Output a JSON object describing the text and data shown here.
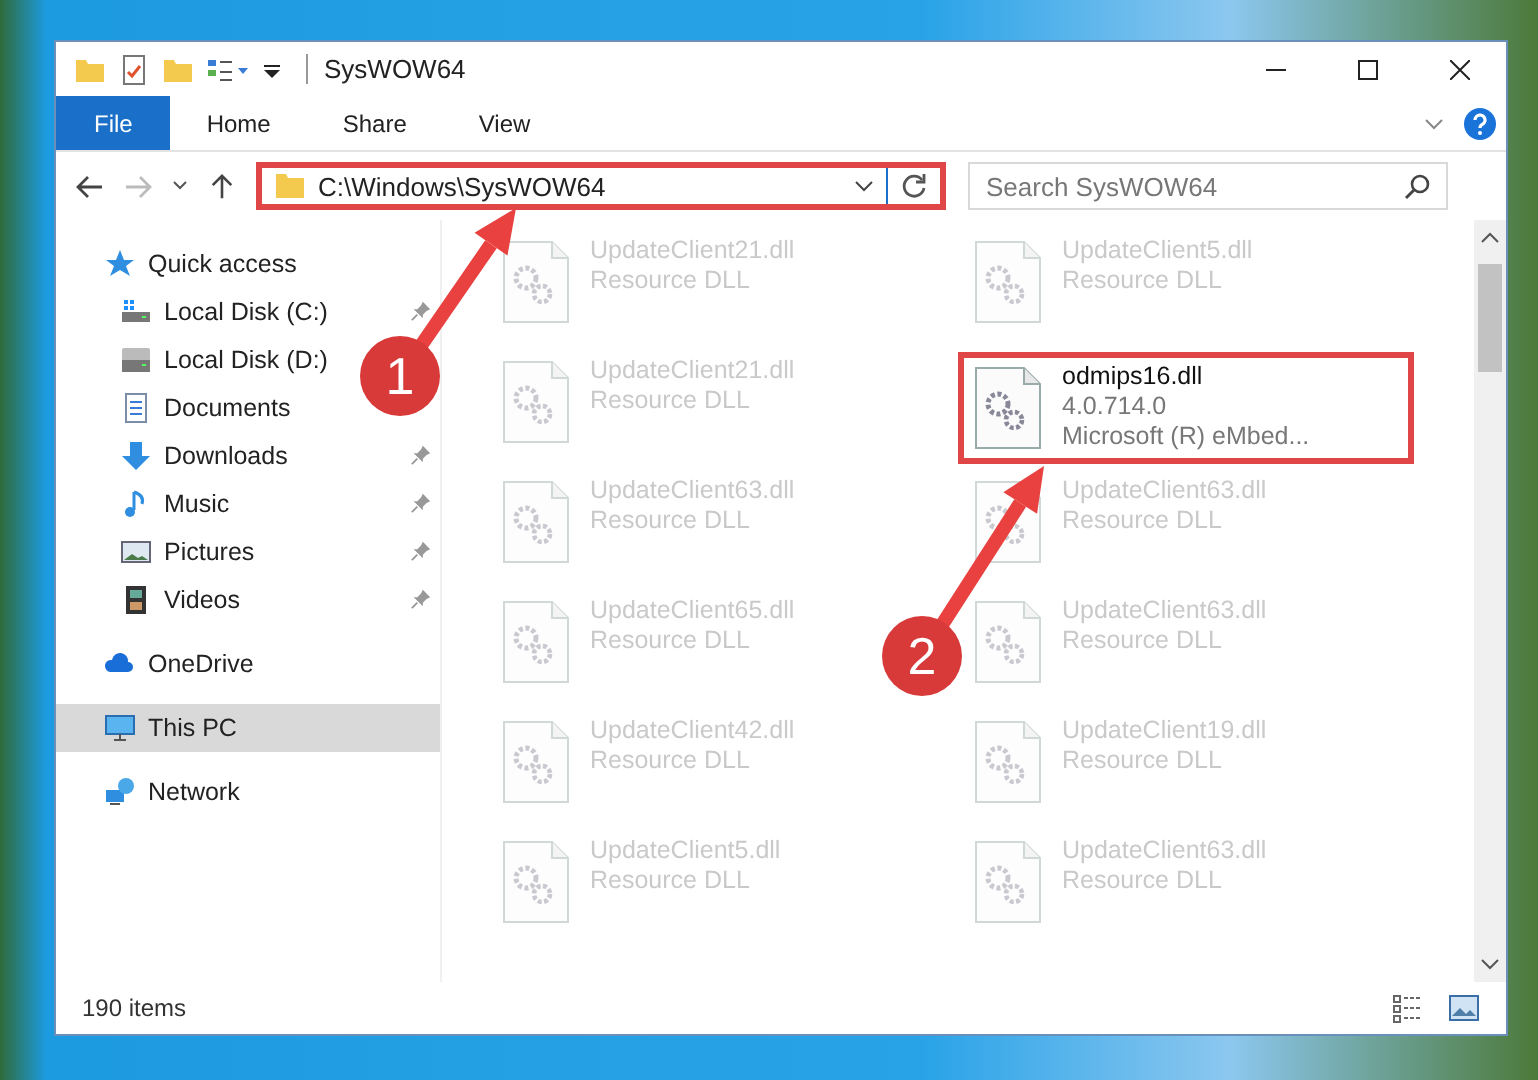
{
  "window": {
    "title": "SysWOW64"
  },
  "ribbon_tabs": [
    {
      "label": "File",
      "selected": true
    },
    {
      "label": "Home",
      "selected": false
    },
    {
      "label": "Share",
      "selected": false
    },
    {
      "label": "View",
      "selected": false
    }
  ],
  "address_bar": {
    "path": "C:\\Windows\\SysWOW64",
    "highlighted": true
  },
  "search": {
    "placeholder": "Search SysWOW64"
  },
  "sidebar": {
    "items": [
      {
        "label": "Quick access",
        "selected": false,
        "children": [
          {
            "label": "Local Disk (C:)",
            "pinned": true,
            "selected": false
          },
          {
            "label": "Local Disk (D:)",
            "pinned": false,
            "selected": false
          },
          {
            "label": "Documents",
            "pinned": false,
            "selected": false
          },
          {
            "label": "Downloads",
            "pinned": true,
            "selected": false
          },
          {
            "label": "Music",
            "pinned": true,
            "selected": false
          },
          {
            "label": "Pictures",
            "pinned": true,
            "selected": false
          },
          {
            "label": "Videos",
            "pinned": true,
            "selected": false
          }
        ]
      },
      {
        "label": "OneDrive",
        "selected": false
      },
      {
        "label": "This PC",
        "selected": true
      },
      {
        "label": "Network",
        "selected": false
      }
    ]
  },
  "files": [
    {
      "kind": "blurred",
      "name": "UpdateClient21.dll",
      "details": [
        "Resource DLL"
      ],
      "highlighted": false
    },
    {
      "kind": "blurred",
      "name": "UpdateClient5.dll",
      "details": [
        "Resource DLL"
      ],
      "highlighted": false
    },
    {
      "kind": "blurred",
      "name": "UpdateClient21.dll",
      "details": [
        "Resource DLL"
      ],
      "highlighted": false
    },
    {
      "kind": "normal",
      "name": "odmips16.dll",
      "details": [
        "4.0.714.0",
        "Microsoft (R) eMbed..."
      ],
      "highlighted": true
    },
    {
      "kind": "blurred",
      "name": "UpdateClient63.dll",
      "details": [
        "Resource DLL"
      ],
      "highlighted": false
    },
    {
      "kind": "blurred",
      "name": "UpdateClient63.dll",
      "details": [
        "Resource DLL"
      ],
      "highlighted": false
    },
    {
      "kind": "blurred",
      "name": "UpdateClient65.dll",
      "details": [
        "Resource DLL"
      ],
      "highlighted": false
    },
    {
      "kind": "blurred",
      "name": "UpdateClient63.dll",
      "details": [
        "Resource DLL"
      ],
      "highlighted": false
    },
    {
      "kind": "blurred",
      "name": "UpdateClient42.dll",
      "details": [
        "Resource DLL"
      ],
      "highlighted": false
    },
    {
      "kind": "blurred",
      "name": "UpdateClient19.dll",
      "details": [
        "Resource DLL"
      ],
      "highlighted": false
    },
    {
      "kind": "blurred",
      "name": "UpdateClient5.dll",
      "details": [
        "Resource DLL"
      ],
      "highlighted": false
    },
    {
      "kind": "blurred",
      "name": "UpdateClient63.dll",
      "details": [
        "Resource DLL"
      ],
      "highlighted": false
    }
  ],
  "status_bar": {
    "item_count": "190 items"
  },
  "annotations": [
    {
      "label": "1"
    },
    {
      "label": "2"
    }
  ]
}
